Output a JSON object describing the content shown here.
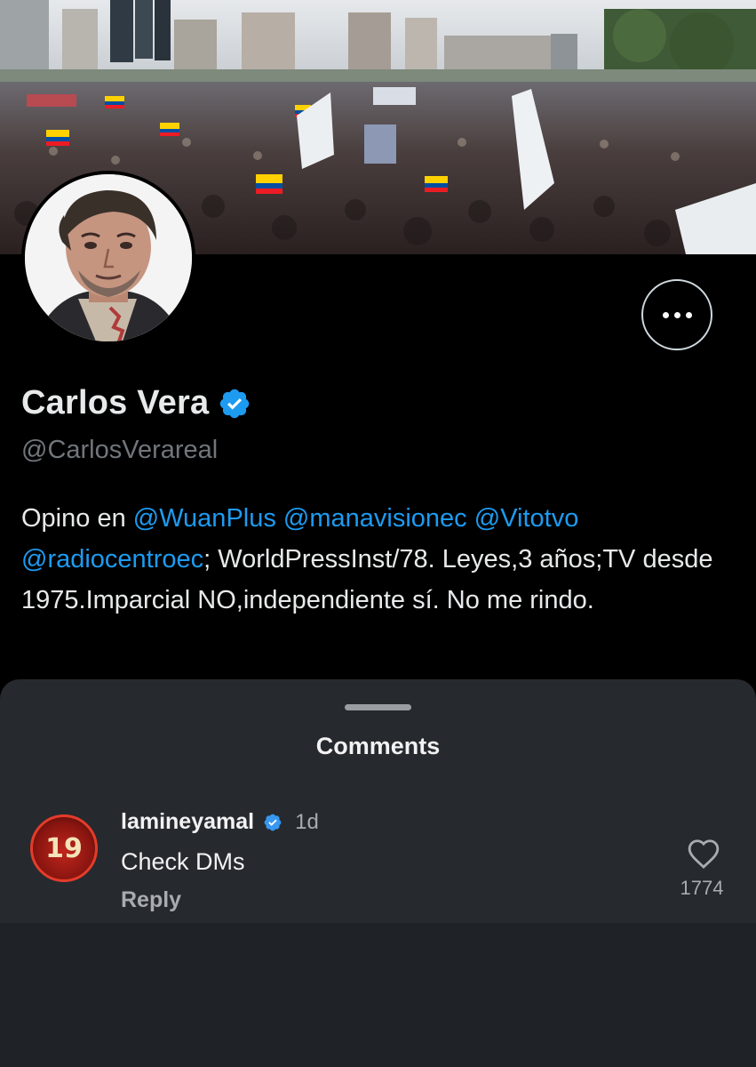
{
  "profile": {
    "display_name": "Carlos Vera",
    "handle": "@CarlosVerareal",
    "verified": true,
    "bio": {
      "prefix": "Opino en ",
      "mentions": [
        "@WuanPlus",
        "@manavisionec",
        "@Vitotvo",
        "@radiocentroec"
      ],
      "rest": "; WorldPressInst/78. Leyes,3 años;TV desde 1975.Imparcial NO,independiente sí. No me rindo."
    },
    "more_button_icon": "more-horizontal-icon"
  },
  "comments_sheet": {
    "title": "Comments",
    "comments": [
      {
        "username": "lamineyamal",
        "verified": true,
        "time": "1d",
        "text": "Check DMs",
        "reply_label": "Reply",
        "like_count": "1774",
        "avatar_text": "19"
      }
    ]
  },
  "colors": {
    "accent": "#1d9bf0",
    "background": "#000000",
    "sheet": "#26292e"
  }
}
